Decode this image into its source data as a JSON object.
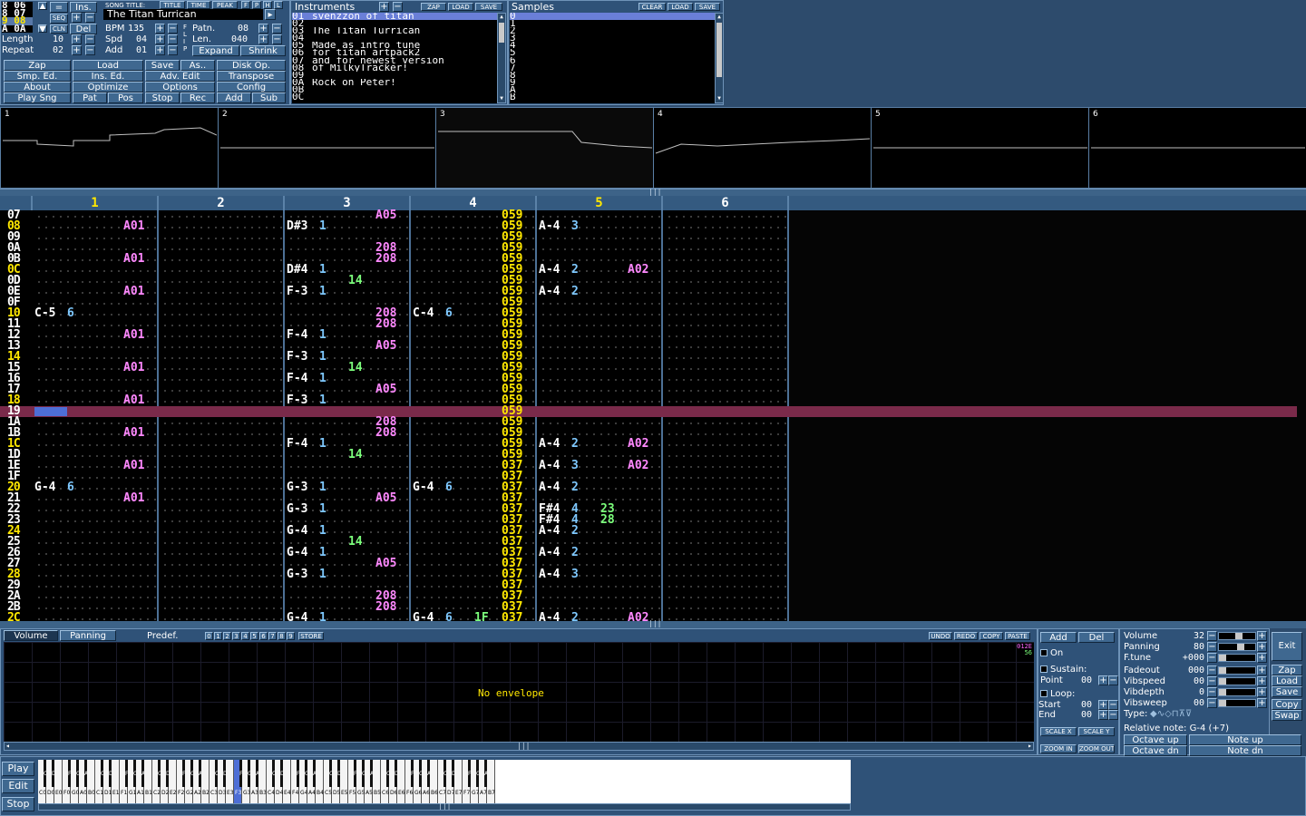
{
  "orders": [
    "8 06",
    "8 07",
    "9 08",
    "A 0A"
  ],
  "song": {
    "length_label": "Length",
    "length": "10",
    "repeat_label": "Repeat",
    "repeat": "02",
    "title_header": "SONG TITLE:",
    "title": "The Titan Turrican",
    "seq": "SEQ",
    "cln": "CLN",
    "ins": "Ins.",
    "del": "Del",
    "eq": "=",
    "bpm_label": "BPM",
    "bpm": "135",
    "spd_label": "Spd",
    "spd": "04",
    "add_label": "Add",
    "add": "01",
    "patn_label": "Patn.",
    "patn": "08",
    "len_label": "Len.",
    "len": "040",
    "expand": "Expand",
    "shrink": "Shrink",
    "title_btn": "TITLE",
    "time_btn": "TIME",
    "peak_btn": "PEAK",
    "f_btn": "F",
    "p_btn": "P",
    "h_btn": "H",
    "l_btn": "L",
    "flip": "F L I P"
  },
  "menu": [
    [
      "Zap",
      "Load",
      "Save",
      "As..",
      "Disk Op."
    ],
    [
      "Smp. Ed.",
      "Ins. Ed.",
      "Adv. Edit",
      "Transpose"
    ],
    [
      "About",
      "Optimize",
      "Options",
      "Config"
    ],
    [
      "Play Sng",
      "Pat",
      "Pos",
      "Stop",
      "Rec",
      "Add",
      "Sub"
    ]
  ],
  "instruments": {
    "title": "Instruments",
    "zap": "ZAP",
    "load": "LOAD",
    "save": "SAVE",
    "items": [
      [
        "01",
        "svenzzon of titan"
      ],
      [
        "02",
        ""
      ],
      [
        "03",
        "The Titan Turrican"
      ],
      [
        "04",
        ""
      ],
      [
        "05",
        "Made as intro tune"
      ],
      [
        "06",
        "for titan artpack2"
      ],
      [
        "07",
        "and for newest version"
      ],
      [
        "08",
        "of MilkyTracker!"
      ],
      [
        "09",
        ""
      ],
      [
        "0A",
        "Rock on Peter!"
      ],
      [
        "0B",
        ""
      ],
      [
        "0C",
        ""
      ]
    ]
  },
  "samples": {
    "title": "Samples",
    "clear": "CLEAR",
    "load": "LOAD",
    "save": "SAVE",
    "items": [
      "0",
      "1",
      "2",
      "3",
      "4",
      "5",
      "6",
      "7",
      "8",
      "9",
      "A",
      "B"
    ]
  },
  "scopes": [
    "1",
    "2",
    "3",
    "4",
    "5",
    "6"
  ],
  "channels": [
    "1",
    "2",
    "3",
    "4",
    "5",
    "6"
  ],
  "rows": [
    "07",
    "08",
    "09",
    "0A",
    "0B",
    "0C",
    "0D",
    "0E",
    "0F",
    "10",
    "11",
    "12",
    "13",
    "14",
    "15",
    "16",
    "17",
    "18",
    "19",
    "1A",
    "1B",
    "1C",
    "1D",
    "1E",
    "1F",
    "20",
    "21",
    "22",
    "23",
    "24",
    "25",
    "26",
    "27",
    "28",
    "29",
    "2A",
    "2B",
    "2C"
  ],
  "cells": [
    {
      "r": "07",
      "c": 3,
      "t": "eff",
      "v": "A05"
    },
    {
      "r": "08",
      "c": 1,
      "t": "eff",
      "v": "A01"
    },
    {
      "r": "08",
      "c": 3,
      "t": "note",
      "v": "D#3"
    },
    {
      "r": "08",
      "c": 3,
      "t": "ins",
      "v": "1"
    },
    {
      "r": "08",
      "c": 5,
      "t": "note",
      "v": "A-4"
    },
    {
      "r": "08",
      "c": 5,
      "t": "ins",
      "v": "3"
    },
    {
      "r": "0A",
      "c": 3,
      "t": "eff",
      "v": "208"
    },
    {
      "r": "0B",
      "c": 1,
      "t": "eff",
      "v": "A01"
    },
    {
      "r": "0B",
      "c": 3,
      "t": "eff",
      "v": "208"
    },
    {
      "r": "0C",
      "c": 3,
      "t": "note",
      "v": "D#4"
    },
    {
      "r": "0C",
      "c": 3,
      "t": "ins",
      "v": "1"
    },
    {
      "r": "0C",
      "c": 5,
      "t": "note",
      "v": "A-4"
    },
    {
      "r": "0C",
      "c": 5,
      "t": "ins",
      "v": "2"
    },
    {
      "r": "0C",
      "c": 5,
      "t": "eff",
      "v": "A02"
    },
    {
      "r": "0D",
      "c": 3,
      "t": "vol",
      "v": "14"
    },
    {
      "r": "0E",
      "c": 1,
      "t": "eff",
      "v": "A01"
    },
    {
      "r": "0E",
      "c": 3,
      "t": "note",
      "v": "F-3"
    },
    {
      "r": "0E",
      "c": 3,
      "t": "ins",
      "v": "1"
    },
    {
      "r": "0E",
      "c": 5,
      "t": "note",
      "v": "A-4"
    },
    {
      "r": "0E",
      "c": 5,
      "t": "ins",
      "v": "2"
    },
    {
      "r": "10",
      "c": 1,
      "t": "note",
      "v": "C-5"
    },
    {
      "r": "10",
      "c": 1,
      "t": "ins",
      "v": "6"
    },
    {
      "r": "10",
      "c": 3,
      "t": "eff",
      "v": "208"
    },
    {
      "r": "10",
      "c": 4,
      "t": "note",
      "v": "C-4"
    },
    {
      "r": "10",
      "c": 4,
      "t": "ins",
      "v": "6"
    },
    {
      "r": "11",
      "c": 3,
      "t": "eff",
      "v": "208"
    },
    {
      "r": "12",
      "c": 1,
      "t": "eff",
      "v": "A01"
    },
    {
      "r": "12",
      "c": 3,
      "t": "note",
      "v": "F-4"
    },
    {
      "r": "12",
      "c": 3,
      "t": "ins",
      "v": "1"
    },
    {
      "r": "13",
      "c": 3,
      "t": "eff",
      "v": "A05"
    },
    {
      "r": "14",
      "c": 3,
      "t": "note",
      "v": "F-3"
    },
    {
      "r": "14",
      "c": 3,
      "t": "ins",
      "v": "1"
    },
    {
      "r": "15",
      "c": 1,
      "t": "eff",
      "v": "A01"
    },
    {
      "r": "15",
      "c": 3,
      "t": "vol",
      "v": "14"
    },
    {
      "r": "16",
      "c": 3,
      "t": "note",
      "v": "F-4"
    },
    {
      "r": "16",
      "c": 3,
      "t": "ins",
      "v": "1"
    },
    {
      "r": "17",
      "c": 3,
      "t": "eff",
      "v": "A05"
    },
    {
      "r": "18",
      "c": 1,
      "t": "eff",
      "v": "A01"
    },
    {
      "r": "18",
      "c": 3,
      "t": "note",
      "v": "F-3"
    },
    {
      "r": "18",
      "c": 3,
      "t": "ins",
      "v": "1"
    },
    {
      "r": "1A",
      "c": 3,
      "t": "eff",
      "v": "208"
    },
    {
      "r": "1B",
      "c": 1,
      "t": "eff",
      "v": "A01"
    },
    {
      "r": "1B",
      "c": 3,
      "t": "eff",
      "v": "208"
    },
    {
      "r": "1C",
      "c": 3,
      "t": "note",
      "v": "F-4"
    },
    {
      "r": "1C",
      "c": 3,
      "t": "ins",
      "v": "1"
    },
    {
      "r": "1C",
      "c": 5,
      "t": "note",
      "v": "A-4"
    },
    {
      "r": "1C",
      "c": 5,
      "t": "ins",
      "v": "2"
    },
    {
      "r": "1C",
      "c": 5,
      "t": "eff",
      "v": "A02"
    },
    {
      "r": "1D",
      "c": 3,
      "t": "vol",
      "v": "14"
    },
    {
      "r": "1E",
      "c": 1,
      "t": "eff",
      "v": "A01"
    },
    {
      "r": "1E",
      "c": 5,
      "t": "note",
      "v": "A-4"
    },
    {
      "r": "1E",
      "c": 5,
      "t": "ins",
      "v": "3"
    },
    {
      "r": "1E",
      "c": 5,
      "t": "eff",
      "v": "A02"
    },
    {
      "r": "20",
      "c": 1,
      "t": "note",
      "v": "G-4"
    },
    {
      "r": "20",
      "c": 1,
      "t": "ins",
      "v": "6"
    },
    {
      "r": "20",
      "c": 3,
      "t": "note",
      "v": "G-3"
    },
    {
      "r": "20",
      "c": 3,
      "t": "ins",
      "v": "1"
    },
    {
      "r": "20",
      "c": 4,
      "t": "note",
      "v": "G-4"
    },
    {
      "r": "20",
      "c": 4,
      "t": "ins",
      "v": "6"
    },
    {
      "r": "20",
      "c": 5,
      "t": "note",
      "v": "A-4"
    },
    {
      "r": "20",
      "c": 5,
      "t": "ins",
      "v": "2"
    },
    {
      "r": "21",
      "c": 1,
      "t": "eff",
      "v": "A01"
    },
    {
      "r": "21",
      "c": 3,
      "t": "eff",
      "v": "A05"
    },
    {
      "r": "22",
      "c": 3,
      "t": "note",
      "v": "G-3"
    },
    {
      "r": "22",
      "c": 3,
      "t": "ins",
      "v": "1"
    },
    {
      "r": "22",
      "c": 5,
      "t": "note",
      "v": "F#4"
    },
    {
      "r": "22",
      "c": 5,
      "t": "ins",
      "v": "4"
    },
    {
      "r": "22",
      "c": 5,
      "t": "vol",
      "v": "23"
    },
    {
      "r": "23",
      "c": 5,
      "t": "note",
      "v": "F#4"
    },
    {
      "r": "23",
      "c": 5,
      "t": "ins",
      "v": "4"
    },
    {
      "r": "23",
      "c": 5,
      "t": "vol",
      "v": "28"
    },
    {
      "r": "24",
      "c": 3,
      "t": "note",
      "v": "G-4"
    },
    {
      "r": "24",
      "c": 3,
      "t": "ins",
      "v": "1"
    },
    {
      "r": "24",
      "c": 5,
      "t": "note",
      "v": "A-4"
    },
    {
      "r": "24",
      "c": 5,
      "t": "ins",
      "v": "2"
    },
    {
      "r": "25",
      "c": 3,
      "t": "vol",
      "v": "14"
    },
    {
      "r": "26",
      "c": 3,
      "t": "note",
      "v": "G-4"
    },
    {
      "r": "26",
      "c": 3,
      "t": "ins",
      "v": "1"
    },
    {
      "r": "26",
      "c": 5,
      "t": "note",
      "v": "A-4"
    },
    {
      "r": "26",
      "c": 5,
      "t": "ins",
      "v": "2"
    },
    {
      "r": "27",
      "c": 3,
      "t": "eff",
      "v": "A05"
    },
    {
      "r": "28",
      "c": 3,
      "t": "note",
      "v": "G-3"
    },
    {
      "r": "28",
      "c": 3,
      "t": "ins",
      "v": "1"
    },
    {
      "r": "28",
      "c": 5,
      "t": "note",
      "v": "A-4"
    },
    {
      "r": "28",
      "c": 5,
      "t": "ins",
      "v": "3"
    },
    {
      "r": "2A",
      "c": 3,
      "t": "eff",
      "v": "208"
    },
    {
      "r": "2B",
      "c": 3,
      "t": "eff",
      "v": "208"
    },
    {
      "r": "2C",
      "c": 3,
      "t": "note",
      "v": "G-4"
    },
    {
      "r": "2C",
      "c": 3,
      "t": "ins",
      "v": "1"
    },
    {
      "r": "2C",
      "c": 4,
      "t": "note",
      "v": "G-4"
    },
    {
      "r": "2C",
      "c": 4,
      "t": "ins",
      "v": "6"
    },
    {
      "r": "2C",
      "c": 4,
      "t": "vol",
      "v": "1F"
    },
    {
      "r": "2C",
      "c": 5,
      "t": "note",
      "v": "A-4"
    },
    {
      "r": "2C",
      "c": 5,
      "t": "ins",
      "v": "2"
    },
    {
      "r": "2C",
      "c": 5,
      "t": "eff",
      "v": "A02"
    }
  ],
  "ch4_params": {
    "07": "059",
    "08": "059",
    "09": "059",
    "0A": "059",
    "0B": "059",
    "0C": "059",
    "0D": "059",
    "0E": "059",
    "0F": "059",
    "10": "059",
    "11": "059",
    "12": "059",
    "13": "059",
    "14": "059",
    "15": "059",
    "16": "059",
    "17": "059",
    "18": "059",
    "19": "059",
    "1A": "059",
    "1B": "059",
    "1C": "059",
    "1D": "059",
    "1E": "037",
    "1F": "037",
    "20": "037",
    "21": "037",
    "22": "037",
    "23": "037",
    "24": "037",
    "25": "037",
    "26": "037",
    "27": "037",
    "28": "037",
    "29": "037",
    "2A": "037",
    "2B": "037",
    "2C": "037"
  },
  "highlight_rows": [
    "08",
    "0C",
    "10",
    "14",
    "18",
    "1C",
    "20",
    "24",
    "28",
    "2C"
  ],
  "current_row": "19",
  "envelope": {
    "tab_volume": "Volume",
    "tab_panning": "Panning",
    "predef": "Predef.",
    "presets": [
      "0",
      "1",
      "2",
      "3",
      "4",
      "5",
      "6",
      "7",
      "8",
      "9"
    ],
    "store": "STORE",
    "undo": "UNDO",
    "redo": "REDO",
    "copy": "COPY",
    "paste": "PASTE",
    "empty": "No envelope",
    "scale_x": "SCALE X",
    "scale_y": "SCALE Y",
    "zoom_in": "ZOOM IN",
    "zoom_out": "ZOOM OUT",
    "corner_top": "012E",
    "corner_bottom": "56"
  },
  "env_ctrl": {
    "add": "Add",
    "del": "Del",
    "on": "On",
    "sustain": "Sustain:",
    "point_label": "Point",
    "point": "00",
    "loop": "Loop:",
    "start_label": "Start",
    "start": "00",
    "end_label": "End",
    "end": "00"
  },
  "inst_params": [
    {
      "label": "Volume",
      "value": "32"
    },
    {
      "label": "Panning",
      "value": "80"
    },
    {
      "label": "F.tune",
      "value": "+000"
    },
    {
      "label": "Fadeout",
      "value": "000"
    },
    {
      "label": "Vibspeed",
      "value": "00"
    },
    {
      "label": "Vibdepth",
      "value": "0"
    },
    {
      "label": "Vibsweep",
      "value": "00"
    }
  ],
  "type_label": "Type:",
  "relative_note": "Relative note: G-4 (+7)",
  "octave_up": "Octave up",
  "octave_dn": "Octave dn",
  "note_up": "Note up",
  "note_dn": "Note dn",
  "side_buttons": [
    "Exit",
    "Zap",
    "Load",
    "Save",
    "Copy",
    "Swap"
  ],
  "transport": [
    "Play",
    "Edit",
    "Stop"
  ],
  "keyboard_octaves": [
    "0",
    "1",
    "2",
    "3",
    "4",
    "5",
    "6",
    "7"
  ],
  "active_key": "F3"
}
